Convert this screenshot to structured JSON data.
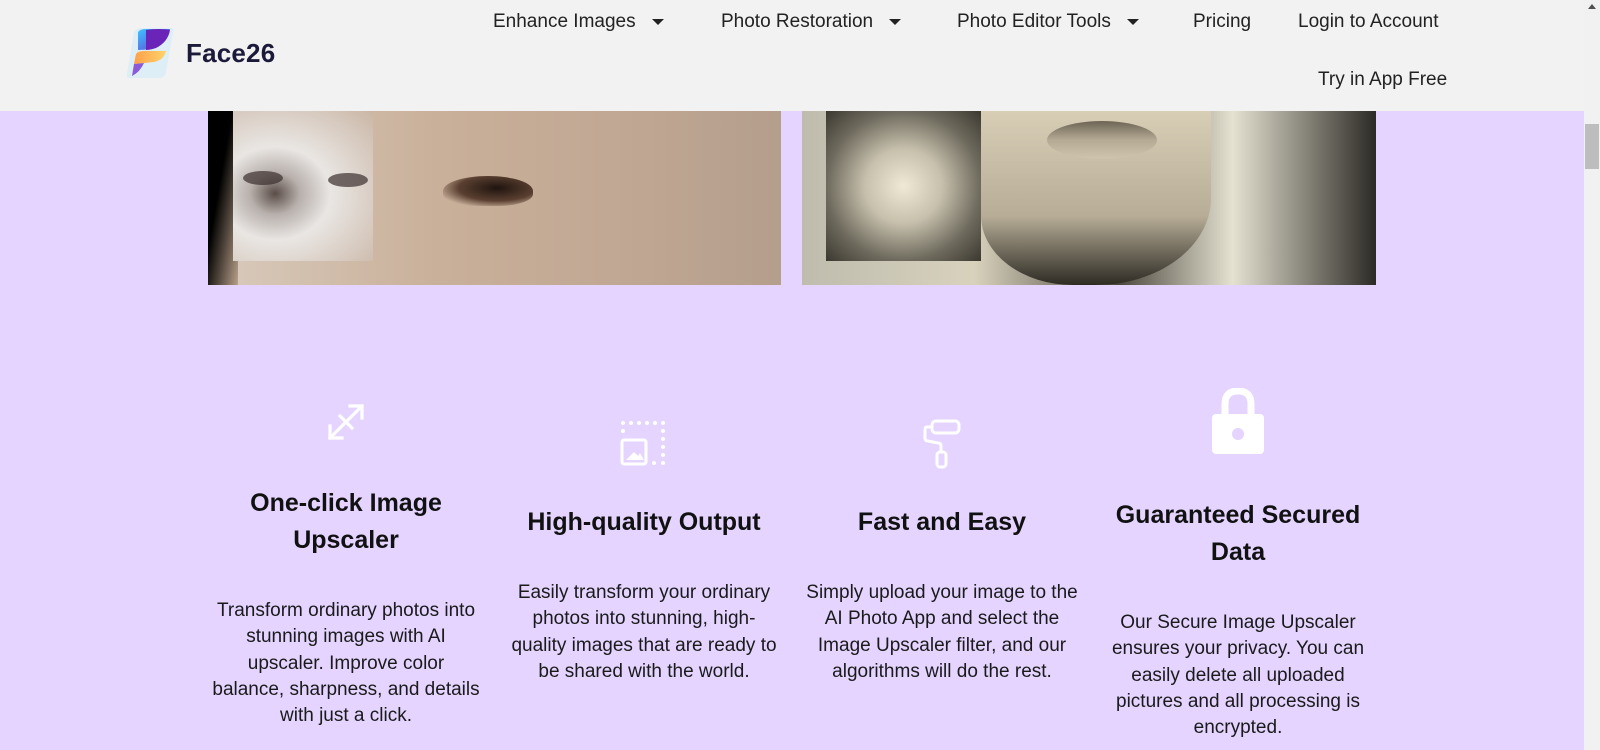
{
  "brand": {
    "name": "Face26"
  },
  "nav": {
    "items": [
      {
        "label": "Enhance Images",
        "has_dropdown": true
      },
      {
        "label": "Photo Restoration",
        "has_dropdown": true
      },
      {
        "label": "Photo Editor Tools",
        "has_dropdown": true
      },
      {
        "label": "Pricing",
        "has_dropdown": false
      },
      {
        "label": "Login to Account",
        "has_dropdown": false
      },
      {
        "label": "Try in App Free",
        "has_dropdown": false
      }
    ]
  },
  "images": [
    {
      "alt": "before-after nose close-up with blurry eyes inset"
    },
    {
      "alt": "before-after vintage portrait of young man with lips close-up"
    }
  ],
  "features": [
    {
      "icon": "resize-arrows-icon",
      "title": "One-click Image Upscaler",
      "description": "Transform ordinary photos into stunning images with AI upscaler. Improve color balance, sharpness, and details with just a click."
    },
    {
      "icon": "image-expand-icon",
      "title": "High-quality Output",
      "description": "Easily transform your ordinary photos into stunning, high-quality images that are ready to be shared with the world."
    },
    {
      "icon": "paint-roller-icon",
      "title": "Fast and Easy",
      "description": "Simply upload your image to the AI Photo App and select the Image Upscaler filter, and our algorithms will do the rest."
    },
    {
      "icon": "lock-icon",
      "title": "Guaranteed Secured Data",
      "description": "Our Secure Image Upscaler ensures your privacy. You can easily delete all uploaded pictures and all processing is encrypted."
    }
  ],
  "colors": {
    "background": "#e4d4ff",
    "header": "#f2f2f2",
    "text": "#111111",
    "icon": "#ffffff"
  }
}
